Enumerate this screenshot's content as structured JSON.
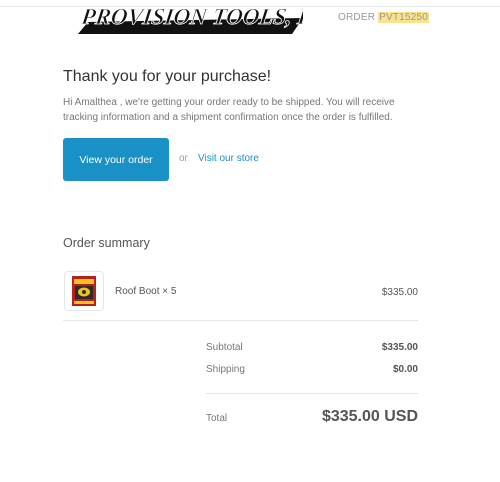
{
  "header": {
    "logo_text": "PROVISION TOOLS, INC",
    "order_prefix": "ORDER",
    "order_number": "PVT15250"
  },
  "main": {
    "heading": "Thank you for your purchase!",
    "message": "Hi Amalthea , we're getting your order ready to be shipped. You will receive tracking information and a shipment confirmation once the order is fulfilled.",
    "view_order_label": "View your order",
    "or_text": "or",
    "visit_store_label": "Visit our store"
  },
  "summary": {
    "title": "Order summary",
    "items": [
      {
        "name": "Roof Boot × 5",
        "price": "$335.00",
        "image_icon": "product-package-icon"
      }
    ],
    "subtotal_label": "Subtotal",
    "subtotal_value": "$335.00",
    "shipping_label": "Shipping",
    "shipping_value": "$0.00",
    "total_label": "Total",
    "total_value": "$335.00 USD"
  },
  "colors": {
    "accent": "#1990c6",
    "highlight": "#fbe38e"
  }
}
